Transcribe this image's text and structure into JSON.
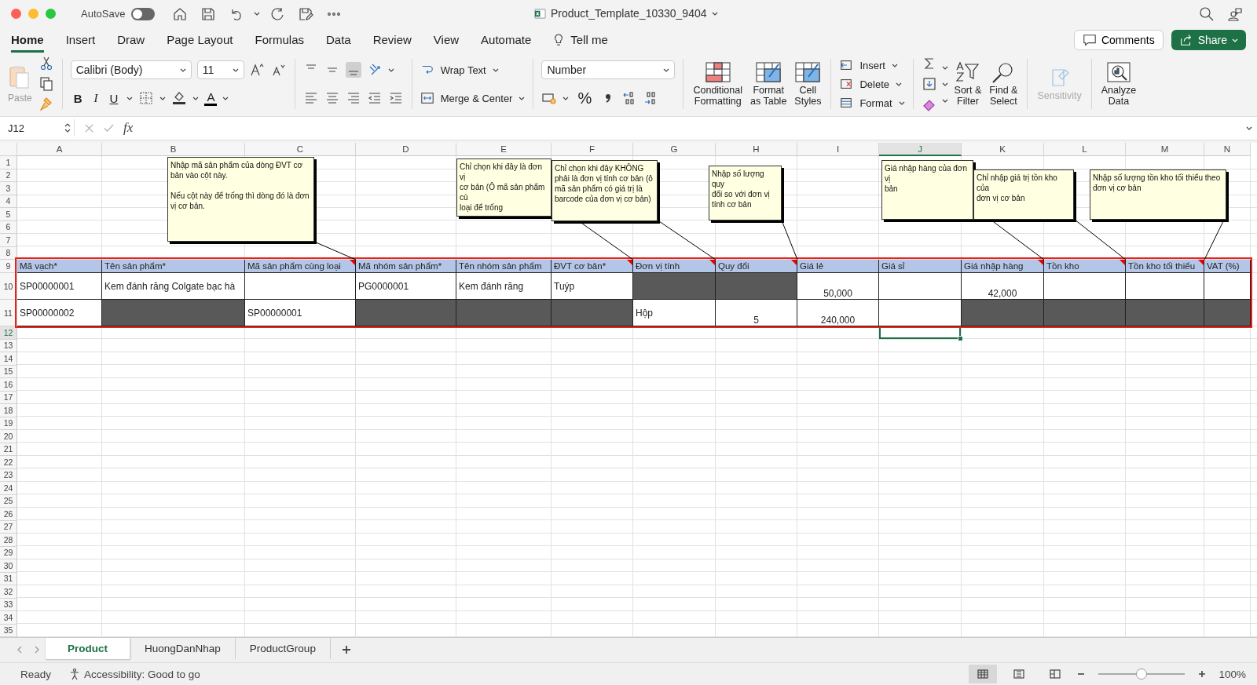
{
  "window": {
    "title": "Product_Template_10330_9404",
    "autosave_label": "AutoSave",
    "autosave_on": false
  },
  "menu_tabs": [
    {
      "label": "Home",
      "selected": true
    },
    {
      "label": "Insert",
      "selected": false
    },
    {
      "label": "Draw",
      "selected": false
    },
    {
      "label": "Page Layout",
      "selected": false
    },
    {
      "label": "Formulas",
      "selected": false
    },
    {
      "label": "Data",
      "selected": false
    },
    {
      "label": "Review",
      "selected": false
    },
    {
      "label": "View",
      "selected": false
    },
    {
      "label": "Automate",
      "selected": false
    }
  ],
  "tell_me": "Tell me",
  "comments_button": "Comments",
  "share_button": "Share",
  "ribbon": {
    "paste": "Paste",
    "font_name": "Calibri (Body)",
    "font_size": "11",
    "bold": "B",
    "italic": "I",
    "underline": "U",
    "font_color": "A",
    "vertical_align": [
      {
        "selected": false
      },
      {
        "selected": false
      },
      {
        "selected": true
      }
    ],
    "wrap_text": "Wrap Text",
    "merge_center": "Merge & Center",
    "number_format": "Number",
    "percent": "%",
    "style_buttons": [
      {
        "lines": [
          "Conditional",
          "Formatting"
        ]
      },
      {
        "lines": [
          "Format",
          "as Table"
        ]
      },
      {
        "lines": [
          "Cell",
          "Styles"
        ]
      }
    ],
    "cells_buttons": [
      "Insert",
      "Delete",
      "Format"
    ],
    "editing_buttons": [
      {
        "lines": [
          "Sort &",
          "Filter"
        ]
      },
      {
        "lines": [
          "Find &",
          "Select"
        ]
      }
    ],
    "sensitivity": {
      "label": "Sensitivity",
      "disabled": true
    },
    "analyze": {
      "lines": [
        "Analyze",
        "Data"
      ]
    }
  },
  "formula_bar": {
    "name_box": "J12",
    "function_label": "fx"
  },
  "sheet": {
    "columns": [
      {
        "label": "A",
        "selected": false
      },
      {
        "label": "B",
        "selected": false
      },
      {
        "label": "C",
        "selected": false
      },
      {
        "label": "D",
        "selected": false
      },
      {
        "label": "E",
        "selected": false
      },
      {
        "label": "F",
        "selected": false
      },
      {
        "label": "G",
        "selected": false
      },
      {
        "label": "H",
        "selected": false
      },
      {
        "label": "I",
        "selected": false
      },
      {
        "label": "J",
        "selected": true
      },
      {
        "label": "K",
        "selected": false
      },
      {
        "label": "L",
        "selected": false
      },
      {
        "label": "M",
        "selected": false
      },
      {
        "label": "N",
        "selected": false
      }
    ],
    "rows": [
      {
        "label": "1",
        "kind": "blank",
        "selected": false
      },
      {
        "label": "2",
        "kind": "blank",
        "selected": false
      },
      {
        "label": "3",
        "kind": "blank",
        "selected": false
      },
      {
        "label": "4",
        "kind": "blank",
        "selected": false
      },
      {
        "label": "5",
        "kind": "blank",
        "selected": false
      },
      {
        "label": "6",
        "kind": "blank",
        "selected": false
      },
      {
        "label": "7",
        "kind": "blank",
        "selected": false
      },
      {
        "label": "8",
        "kind": "blank",
        "selected": false
      },
      {
        "label": "9",
        "kind": "header",
        "selected": false,
        "highlighted": true,
        "cells": [
          {
            "value": "Mã vạch*",
            "has_comment": false
          },
          {
            "value": "Tên sản phẩm*",
            "has_comment": false
          },
          {
            "value": "Mã sản phẩm cùng loại",
            "has_comment": true
          },
          {
            "value": "Mã nhóm sản phẩm*",
            "has_comment": false
          },
          {
            "value": "Tên nhóm sản phẩm",
            "has_comment": false
          },
          {
            "value": "ĐVT cơ bản*",
            "has_comment": true
          },
          {
            "value": "Đơn vị tính",
            "has_comment": true
          },
          {
            "value": "Quy đổi",
            "has_comment": true
          },
          {
            "value": "Giá lẻ",
            "has_comment": false
          },
          {
            "value": "Giá sỉ",
            "has_comment": false
          },
          {
            "value": "Giá nhập hàng",
            "has_comment": true
          },
          {
            "value": "Tồn kho",
            "has_comment": true
          },
          {
            "value": "Tồn kho tối thiểu",
            "has_comment": true
          },
          {
            "value": "VAT (%)",
            "has_comment": false
          }
        ]
      },
      {
        "label": "10",
        "kind": "data",
        "selected": false,
        "highlighted": true,
        "cells": [
          {
            "kind": "text",
            "value": "SP00000001",
            "shaded": false
          },
          {
            "kind": "text",
            "value": "Kem đánh răng Colgate bạc hà",
            "shaded": false
          },
          {
            "kind": "empty",
            "shaded": false
          },
          {
            "kind": "text",
            "value": "PG0000001",
            "shaded": false
          },
          {
            "kind": "text",
            "value": "Kem đánh răng",
            "shaded": false
          },
          {
            "kind": "text",
            "value": "Tuýp",
            "shaded": false
          },
          {
            "kind": "empty",
            "shaded": true
          },
          {
            "kind": "empty",
            "shaded": true
          },
          {
            "kind": "number",
            "value": "50,000",
            "shaded": false
          },
          {
            "kind": "empty",
            "shaded": false
          },
          {
            "kind": "number",
            "value": "42,000",
            "shaded": false
          },
          {
            "kind": "empty",
            "shaded": false
          },
          {
            "kind": "empty",
            "shaded": false
          },
          {
            "kind": "empty",
            "shaded": false
          }
        ]
      },
      {
        "label": "11",
        "kind": "data",
        "selected": false,
        "highlighted": true,
        "cells": [
          {
            "kind": "text",
            "value": "SP00000002",
            "shaded": false
          },
          {
            "kind": "empty",
            "shaded": true
          },
          {
            "kind": "text",
            "value": "SP00000001",
            "shaded": false
          },
          {
            "kind": "empty",
            "shaded": true
          },
          {
            "kind": "empty",
            "shaded": true
          },
          {
            "kind": "empty",
            "shaded": true
          },
          {
            "kind": "text",
            "value": "Hộp",
            "shaded": false
          },
          {
            "kind": "number",
            "value": "5",
            "shaded": false
          },
          {
            "kind": "number",
            "value": "240,000",
            "shaded": false
          },
          {
            "kind": "empty",
            "shaded": false
          },
          {
            "kind": "empty",
            "shaded": true
          },
          {
            "kind": "empty",
            "shaded": true
          },
          {
            "kind": "empty",
            "shaded": true
          },
          {
            "kind": "empty",
            "shaded": true
          }
        ]
      },
      {
        "label": "12",
        "kind": "blank",
        "selected": true
      },
      {
        "label": "13",
        "kind": "blank",
        "selected": false
      },
      {
        "label": "14",
        "kind": "blank",
        "selected": false
      },
      {
        "label": "15",
        "kind": "blank",
        "selected": false
      },
      {
        "label": "16",
        "kind": "blank",
        "selected": false
      },
      {
        "label": "17",
        "kind": "blank",
        "selected": false
      },
      {
        "label": "18",
        "kind": "blank",
        "selected": false
      },
      {
        "label": "19",
        "kind": "blank",
        "selected": false
      },
      {
        "label": "20",
        "kind": "blank",
        "selected": false
      },
      {
        "label": "21",
        "kind": "blank",
        "selected": false
      },
      {
        "label": "22",
        "kind": "blank",
        "selected": false
      },
      {
        "label": "23",
        "kind": "blank",
        "selected": false
      },
      {
        "label": "24",
        "kind": "blank",
        "selected": false
      },
      {
        "label": "25",
        "kind": "blank",
        "selected": false
      },
      {
        "label": "26",
        "kind": "blank",
        "selected": false
      },
      {
        "label": "27",
        "kind": "blank",
        "selected": false
      },
      {
        "label": "28",
        "kind": "blank",
        "selected": false
      },
      {
        "label": "29",
        "kind": "blank",
        "selected": false
      },
      {
        "label": "30",
        "kind": "blank",
        "selected": false
      },
      {
        "label": "31",
        "kind": "blank",
        "selected": false
      },
      {
        "label": "32",
        "kind": "blank",
        "selected": false
      },
      {
        "label": "33",
        "kind": "blank",
        "selected": false
      },
      {
        "label": "34",
        "kind": "blank",
        "selected": false
      },
      {
        "label": "35",
        "kind": "blank",
        "selected": false
      }
    ],
    "comments": [
      {
        "text": "Nhập mã sản phẩm của dòng ĐVT cơ\nbản vào cột này.\n\nNếu cột này để trống thì dòng đó là đơn\nvị cơ bản."
      },
      {
        "text": "Chỉ chọn khi đây là đơn vị\ncơ bản (Ô mã sản phẩm cù\nloại để trống"
      },
      {
        "text": "Chỉ chọn khi đây KHÔNG\nphải là đơn vị tính cơ bản (ô\nmã sản phẩm có giá trị là\nbarcode của đơn vị cơ bản)"
      },
      {
        "text": "Nhập số lượng quy\nđổi so với đơn vị\ntính cơ bản"
      },
      {
        "text": "Giá nhập hàng của đơn vị\nbản"
      },
      {
        "text": "Chỉ nhập giá trị tồn kho của\nđơn vị cơ bản"
      },
      {
        "text": "Nhập số lượng tồn kho tối thiểu theo\nđơn vị cơ bản"
      }
    ]
  },
  "sheet_tabs": [
    {
      "label": "Product",
      "selected": true
    },
    {
      "label": "HuongDanNhap",
      "selected": false
    },
    {
      "label": "ProductGroup",
      "selected": false
    }
  ],
  "status_bar": {
    "status": "Ready",
    "accessibility": "Accessibility: Good to go",
    "views": [
      {
        "selected": true
      },
      {
        "selected": false
      },
      {
        "selected": false
      }
    ],
    "zoom": "100%",
    "zoom_level": {
      "level": 0.5
    }
  }
}
